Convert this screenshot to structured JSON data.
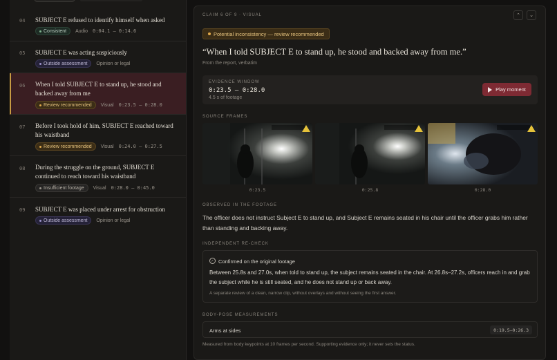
{
  "claims_list": [
    {
      "num": "04",
      "text": "SUBJECT E refused to identify himself when asked",
      "badge": "Consistent",
      "kind": "Audio",
      "range": "0:04.1 – 0:14.6"
    },
    {
      "num": "05",
      "text": "SUBJECT E was acting suspiciously",
      "badge": "Outside assessment",
      "kind": "Opinion or legal",
      "range": ""
    },
    {
      "num": "06",
      "text": "When I told SUBJECT E to stand up, he stood and backed away from me",
      "badge": "Review recommended",
      "kind": "Visual",
      "range": "0:23.5 – 0:28.0"
    },
    {
      "num": "07",
      "text": "Before I took hold of him, SUBJECT E reached toward his waistband",
      "badge": "Review recommended",
      "kind": "Visual",
      "range": "0:24.0 – 0:27.5"
    },
    {
      "num": "08",
      "text": "During the struggle on the ground, SUBJECT E continued to reach toward his waistband",
      "badge": "Insufficient footage",
      "kind": "Visual",
      "range": "0:28.0 – 0:45.0"
    },
    {
      "num": "09",
      "text": "SUBJECT E was placed under arrest for obstruction",
      "badge": "Outside assessment",
      "kind": "Opinion or legal",
      "range": ""
    }
  ],
  "detail": {
    "header": "CLAIM 6 OF 9 · VISUAL",
    "nav_up": "⌃",
    "nav_down": "⌄",
    "warning": "Potential inconsistency — review recommended",
    "quote": "“When I told SUBJECT E to stand up, he stood and backed away from me.”",
    "quote_source": "From the report, verbatim",
    "evidence": {
      "caption": "EVIDENCE WINDOW",
      "range": "0:23.5 – 0:28.0",
      "duration": "4.5 s of footage",
      "play_label": "Play moment"
    },
    "source_frames": {
      "caption": "SOURCE FRAMES",
      "times": [
        "0:23.5",
        "0:25.8",
        "0:28.0"
      ]
    },
    "observed": {
      "caption": "OBSERVED IN THE FOOTAGE",
      "text": "The officer does not instruct Subject E to stand up, and Subject E remains seated in his chair until the officer grabs him rather than standing and backing away."
    },
    "recheck": {
      "caption": "INDEPENDENT RE-CHECK",
      "title": "Confirmed on the original footage",
      "body": "Between 25.8s and 27.0s, when told to stand up, the subject remains seated in the chair. At 26.8s–27.2s, officers reach in and grab the subject while he is still seated, and he does not stand up or back away.",
      "note": "A separate review of a clean, narrow clip, without overlays and without seeing the first answer."
    },
    "pose": {
      "caption": "BODY-POSE MEASUREMENTS",
      "label": "Arms at sides",
      "range": "0:19.5–0:26.3",
      "note": "Measured from body keypoints at 10 frames per second. Supporting evidence only; it never sets the status."
    }
  },
  "colors": {
    "accent_amber": "#e0a84a",
    "play_button": "#7e2a33",
    "selected_row": "#3a1e22"
  }
}
